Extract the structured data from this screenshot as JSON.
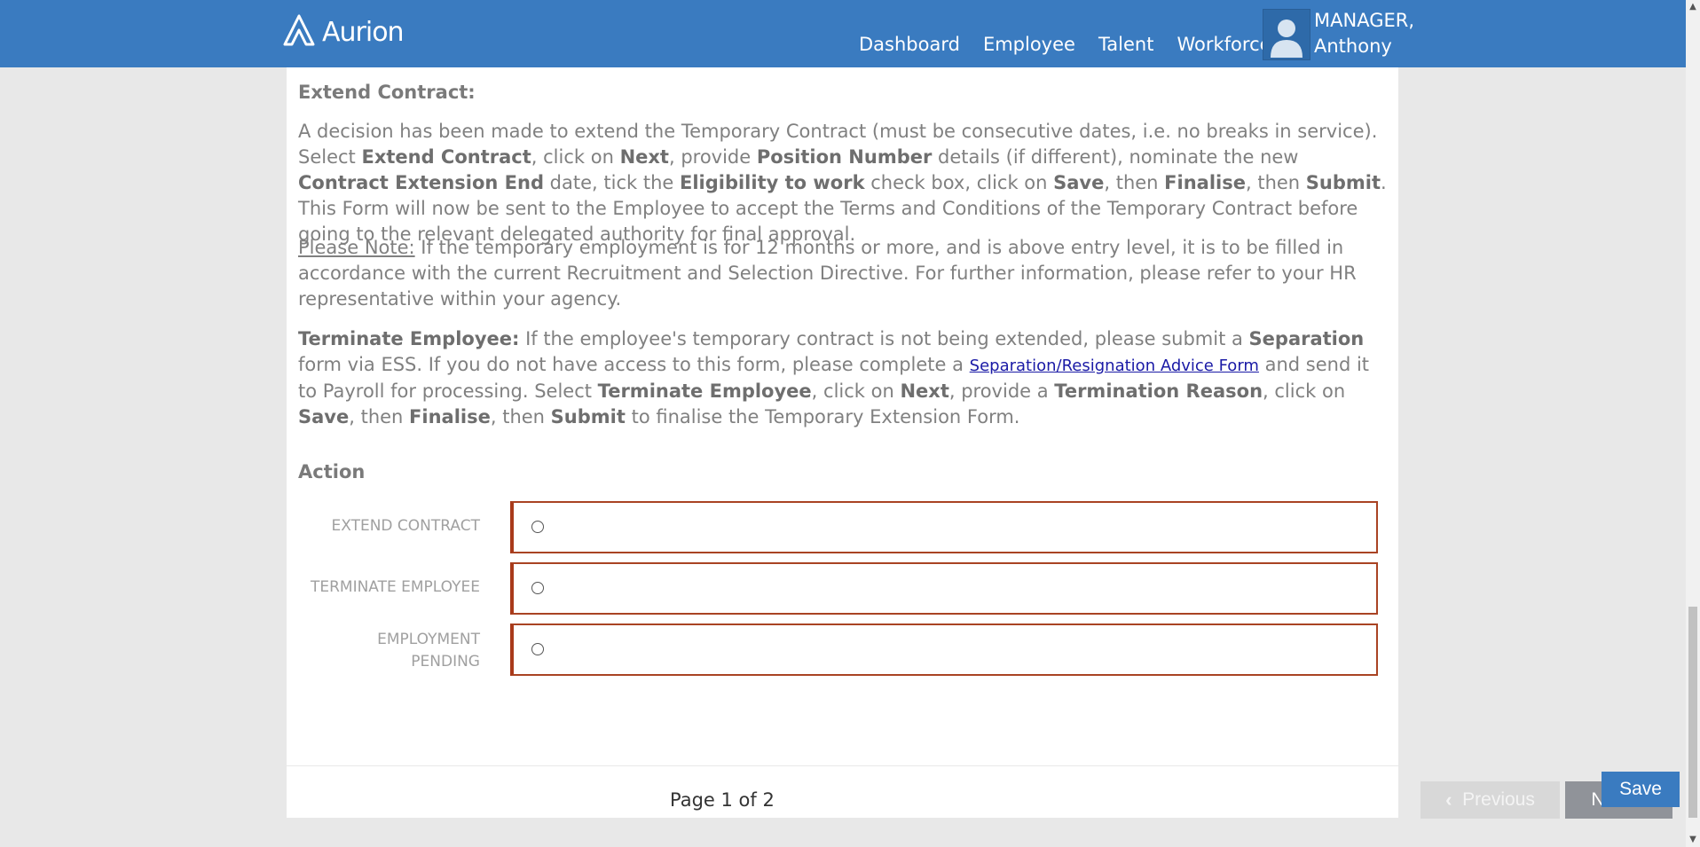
{
  "header": {
    "logo_text": "Aurion",
    "nav": [
      "Dashboard",
      "Employee",
      "Talent",
      "Workforce"
    ],
    "user_line1": "MANAGER,",
    "user_line2": "Anthony"
  },
  "extend": {
    "title": "Extend Contract:",
    "p1": [
      {
        "t": "A decision has been made to extend the Temporary Contract (must be consecutive dates, i.e. no breaks in service). Select "
      },
      {
        "t": "Extend Contract",
        "b": true
      },
      {
        "t": ", click on "
      },
      {
        "t": "Next",
        "b": true
      },
      {
        "t": ", provide "
      },
      {
        "t": "Position Number",
        "b": true
      },
      {
        "t": " details (if different), nominate the new "
      },
      {
        "t": "Contract Extension End",
        "b": true
      },
      {
        "t": " date, tick the "
      },
      {
        "t": "Eligibility to work",
        "b": true
      },
      {
        "t": " check box, click on "
      },
      {
        "t": "Save",
        "b": true
      },
      {
        "t": ", then "
      },
      {
        "t": "Finalise",
        "b": true
      },
      {
        "t": ", then "
      },
      {
        "t": "Submit",
        "b": true
      },
      {
        "t": ". This Form will now be sent to the Employee to accept the Terms and Conditions of the Temporary Contract before going to the relevant delegated authority for final approval."
      }
    ],
    "note_label": "Please Note:",
    "note_text": " If the temporary employment is for 12 months or more, and is above entry level, it is to be filled in accordance with the current Recruitment and Selection Directive. For further information, please refer to your HR representative within your agency."
  },
  "terminate": {
    "p": [
      {
        "t": "Terminate Employee:",
        "b": true
      },
      {
        "t": " If the employee's temporary contract is not being extended, please submit a "
      },
      {
        "t": "Separation",
        "b": true
      },
      {
        "t": " form via ESS. If you do not have access to this form, please complete a "
      },
      {
        "t": "Separation/Resignation Advice Form",
        "link": true
      },
      {
        "t": " and send it to Payroll for processing. Select "
      },
      {
        "t": "Terminate Employee",
        "b": true
      },
      {
        "t": ", click on "
      },
      {
        "t": "Next",
        "b": true
      },
      {
        "t": ", provide a "
      },
      {
        "t": "Termination Reason",
        "b": true
      },
      {
        "t": ", click on "
      },
      {
        "t": "Save",
        "b": true
      },
      {
        "t": ", then "
      },
      {
        "t": "Finalise",
        "b": true
      },
      {
        "t": ", then "
      },
      {
        "t": "Submit",
        "b": true
      },
      {
        "t": " to finalise the Temporary Extension Form."
      }
    ]
  },
  "action": {
    "title": "Action",
    "options": [
      "EXTEND CONTRACT",
      "TERMINATE EMPLOYEE",
      "EMPLOYMENT PENDING"
    ]
  },
  "footer": {
    "page_label": "Page 1 of 2",
    "previous_label": "Previous",
    "next_label": "Next",
    "save_label": "Save"
  },
  "colors": {
    "header_bg": "#3a7bc0",
    "required_border": "#a93a1a"
  }
}
